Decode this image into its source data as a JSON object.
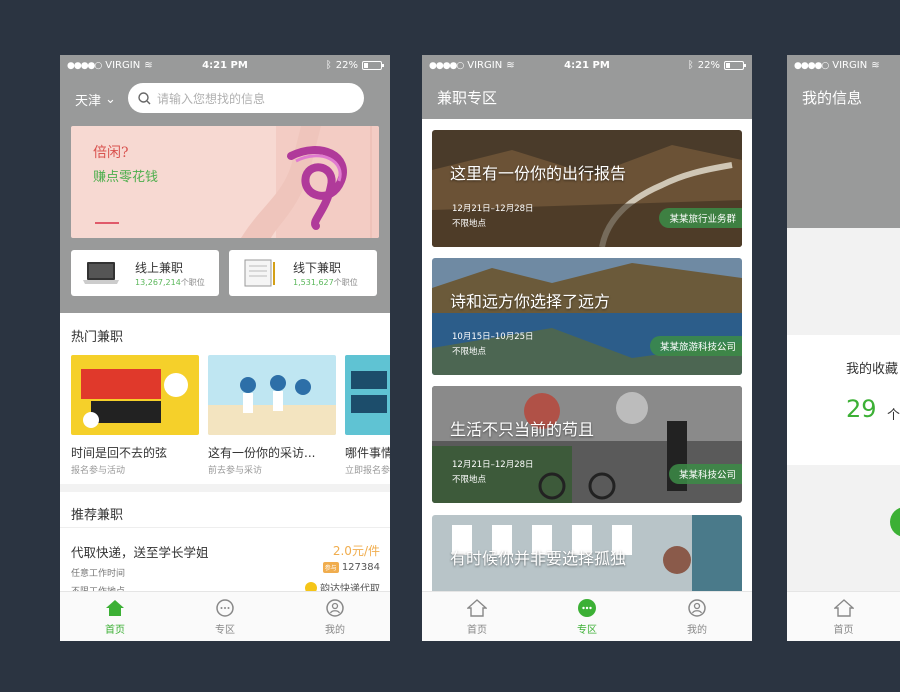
{
  "status": {
    "carrier": "VIRGIN",
    "time": "4:21 PM",
    "battery": "22%"
  },
  "tabs": {
    "home": "首页",
    "zone": "专区",
    "mine": "我的"
  },
  "colors": {
    "accent": "#3cb035",
    "header": "#999a9a",
    "price": "#f0ad4e",
    "background": "#2b3441"
  },
  "home": {
    "city": "天津",
    "search_placeholder": "请输入您想找的信息",
    "banner": {
      "line1": "倍闲?",
      "line2": "赚点零花钱"
    },
    "cards": [
      {
        "name": "线上兼职",
        "count": "13,267,214",
        "unit": "个职位",
        "icon": "laptop-icon"
      },
      {
        "name": "线下兼职",
        "count": "1,531,627",
        "unit": "个职位",
        "icon": "notebook-icon"
      }
    ],
    "hot_title": "热门兼职",
    "hot": [
      {
        "name": "时间是回不去的弦",
        "sub": "报名参与活动"
      },
      {
        "name": "这有一份你的采访...",
        "sub": "前去参与采访"
      },
      {
        "name": "哪件事情",
        "sub": "立即报名参"
      }
    ],
    "rec_title": "推荐兼职",
    "rec": {
      "title": "代取快递，送至学长学姐",
      "time": "任意工作时间",
      "place": "不限工作地点",
      "price": "2.0元/件",
      "tag": "参与",
      "views": "127384",
      "company": "韵达快递代取"
    }
  },
  "zone": {
    "title": "兼职专区",
    "items": [
      {
        "title": "这里有一份你的出行报告",
        "date": "12月21日–12月28日",
        "place": "不限地点",
        "org": "某某旅行业务群"
      },
      {
        "title": "诗和远方你选择了远方",
        "date": "10月15日–10月25日",
        "place": "不限地点",
        "org": "某某旅游科技公司"
      },
      {
        "title": "生活不只当前的苟且",
        "date": "12月21日–12月28日",
        "place": "不限地点",
        "org": "某某科技公司"
      },
      {
        "title": "有时候你并非要选择孤独",
        "date": "",
        "place": "",
        "org": ""
      }
    ]
  },
  "mine": {
    "title": "我的信息",
    "collect_label": "我的收藏",
    "collect_count": "29",
    "collect_unit": "个"
  }
}
